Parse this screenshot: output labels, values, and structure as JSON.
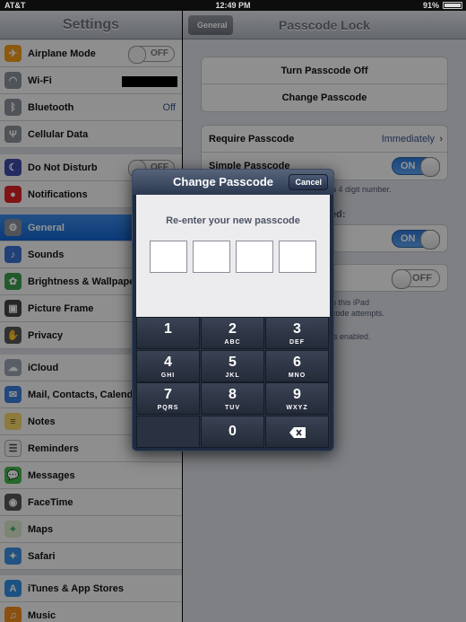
{
  "status": {
    "carrier": "AT&T",
    "time": "12:49 PM",
    "battery": "91%"
  },
  "left": {
    "title": "Settings",
    "items": [
      {
        "label": "Airplane Mode",
        "icon": "airplane-icon",
        "toggle": "OFF"
      },
      {
        "label": "Wi-Fi",
        "icon": "wifi-icon"
      },
      {
        "label": "Bluetooth",
        "icon": "bluetooth-icon",
        "value": "Off"
      },
      {
        "label": "Cellular Data",
        "icon": "antenna-icon"
      },
      {
        "label": "Do Not Disturb",
        "icon": "moon-icon",
        "toggle": "OFF"
      },
      {
        "label": "Notifications",
        "icon": "notifications-icon"
      },
      {
        "label": "General",
        "icon": "gear-icon"
      },
      {
        "label": "Sounds",
        "icon": "speaker-icon"
      },
      {
        "label": "Brightness & Wallpaper",
        "icon": "flower-icon"
      },
      {
        "label": "Picture Frame",
        "icon": "picture-frame-icon"
      },
      {
        "label": "Privacy",
        "icon": "hand-icon"
      },
      {
        "label": "iCloud",
        "icon": "cloud-icon"
      },
      {
        "label": "Mail, Contacts, Calendars",
        "icon": "mail-icon"
      },
      {
        "label": "Notes",
        "icon": "notes-icon"
      },
      {
        "label": "Reminders",
        "icon": "reminders-icon"
      },
      {
        "label": "Messages",
        "icon": "message-icon"
      },
      {
        "label": "FaceTime",
        "icon": "camera-icon"
      },
      {
        "label": "Maps",
        "icon": "map-icon"
      },
      {
        "label": "Safari",
        "icon": "compass-icon"
      },
      {
        "label": "iTunes & App Stores",
        "icon": "app-store-icon"
      },
      {
        "label": "Music",
        "icon": "music-icon"
      }
    ]
  },
  "right": {
    "title": "Passcode Lock",
    "back": "General",
    "turn_off": "Turn Passcode Off",
    "change": "Change Passcode",
    "require_label": "Require Passcode",
    "require_value": "Immediately",
    "simple_label": "Simple Passcode",
    "simple_toggle": "ON",
    "simple_note": "a 4 digit number.",
    "section_fragment": "ed:",
    "toggle2": "ON",
    "toggle3": "OFF",
    "note2a": "n this iPad",
    "note2b": "code attempts.",
    "note3": "is enabled."
  },
  "modal": {
    "title": "Change Passcode",
    "cancel": "Cancel",
    "prompt": "Re-enter your new passcode",
    "keys": [
      {
        "digit": "1",
        "letters": ""
      },
      {
        "digit": "2",
        "letters": "ABC"
      },
      {
        "digit": "3",
        "letters": "DEF"
      },
      {
        "digit": "4",
        "letters": "GHI"
      },
      {
        "digit": "5",
        "letters": "JKL"
      },
      {
        "digit": "6",
        "letters": "MNO"
      },
      {
        "digit": "7",
        "letters": "PQRS"
      },
      {
        "digit": "8",
        "letters": "TUV"
      },
      {
        "digit": "9",
        "letters": "WXYZ"
      },
      {
        "digit": "0",
        "letters": ""
      }
    ]
  }
}
